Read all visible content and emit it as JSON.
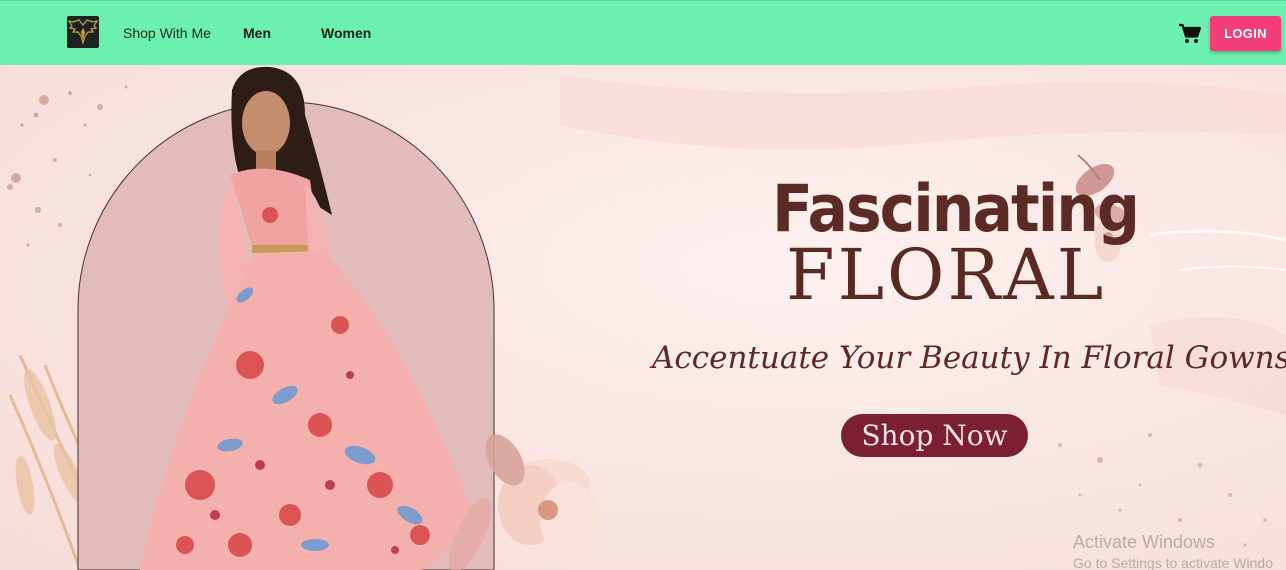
{
  "header": {
    "brand": "Shop With Me",
    "nav": {
      "men": "Men",
      "women": "Women"
    },
    "login_label": "LOGIN",
    "icons": {
      "logo": "eagle-logo-icon",
      "cart": "shopping-cart-icon"
    }
  },
  "hero": {
    "headline_top": "Fascinating",
    "headline_bottom": "FLORAL",
    "tagline": "Accentuate Your Beauty In Floral Gowns.",
    "cta_label": "Shop Now"
  },
  "os_watermark": {
    "line1": "Activate Windows",
    "line2": "Go to Settings to activate Windo"
  },
  "colors": {
    "topbar": "#6cf0b0",
    "login_button": "#f23d78",
    "cta_button": "#7a1f35",
    "headline": "#5d2b25",
    "hero_background": "#fbe9e6"
  }
}
